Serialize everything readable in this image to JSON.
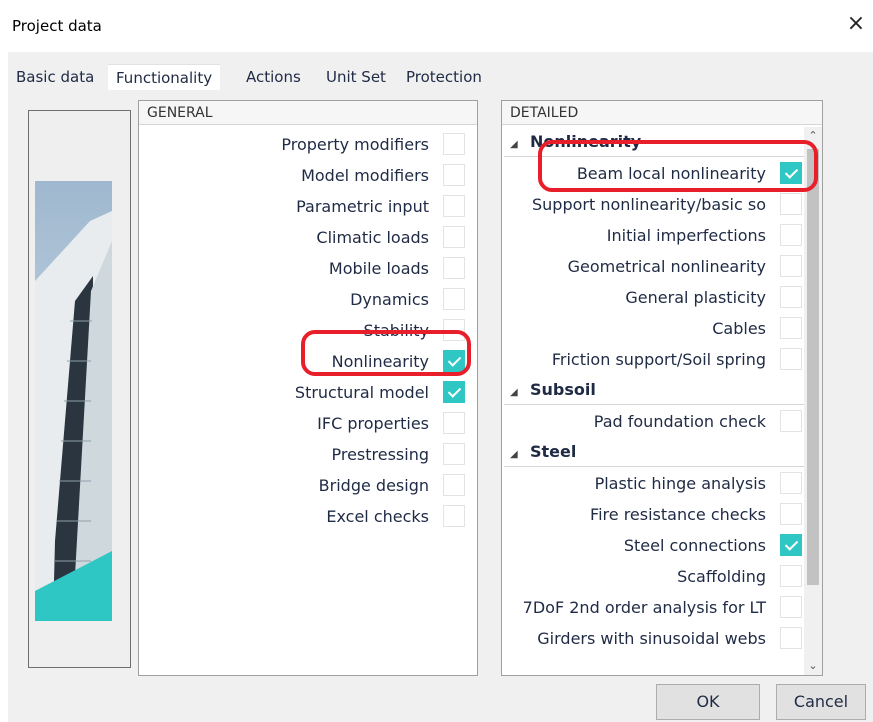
{
  "window": {
    "title": "Project data",
    "close_icon": "×"
  },
  "tabs": [
    {
      "label": "Basic data",
      "active": false
    },
    {
      "label": "Functionality",
      "active": true
    },
    {
      "label": "Actions",
      "active": false
    },
    {
      "label": "Unit Set",
      "active": false
    },
    {
      "label": "Protection",
      "active": false
    }
  ],
  "general": {
    "header": "GENERAL",
    "items": [
      {
        "label": "Property modifiers",
        "checked": false
      },
      {
        "label": "Model modifiers",
        "checked": false
      },
      {
        "label": "Parametric input",
        "checked": false
      },
      {
        "label": "Climatic loads",
        "checked": false
      },
      {
        "label": "Mobile loads",
        "checked": false
      },
      {
        "label": "Dynamics",
        "checked": false
      },
      {
        "label": "Stability",
        "checked": false
      },
      {
        "label": "Nonlinearity",
        "checked": true
      },
      {
        "label": "Structural model",
        "checked": true
      },
      {
        "label": "IFC properties",
        "checked": false
      },
      {
        "label": "Prestressing",
        "checked": false
      },
      {
        "label": "Bridge design",
        "checked": false
      },
      {
        "label": "Excel checks",
        "checked": false
      }
    ]
  },
  "detailed": {
    "header": "DETAILED",
    "groups": [
      {
        "title": "Nonlinearity",
        "items": [
          {
            "label": "Beam local nonlinearity",
            "checked": true
          },
          {
            "label": "Support nonlinearity/basic so",
            "checked": false
          },
          {
            "label": "Initial imperfections",
            "checked": false
          },
          {
            "label": "Geometrical nonlinearity",
            "checked": false
          },
          {
            "label": "General plasticity",
            "checked": false
          },
          {
            "label": "Cables",
            "checked": false
          },
          {
            "label": "Friction support/Soil spring",
            "checked": false
          }
        ]
      },
      {
        "title": "Subsoil",
        "items": [
          {
            "label": "Pad foundation check",
            "checked": false
          }
        ]
      },
      {
        "title": "Steel",
        "items": [
          {
            "label": "Plastic hinge analysis",
            "checked": false
          },
          {
            "label": "Fire resistance checks",
            "checked": false
          },
          {
            "label": "Steel connections",
            "checked": true
          },
          {
            "label": "Scaffolding",
            "checked": false
          },
          {
            "label": "7DoF 2nd order analysis for LT",
            "checked": false
          },
          {
            "label": "Girders with sinusoidal webs",
            "checked": false
          }
        ]
      }
    ]
  },
  "buttons": {
    "ok": "OK",
    "cancel": "Cancel"
  },
  "colors": {
    "checkbox_on": "#2ec7c4",
    "highlight": "#e81f2a"
  }
}
